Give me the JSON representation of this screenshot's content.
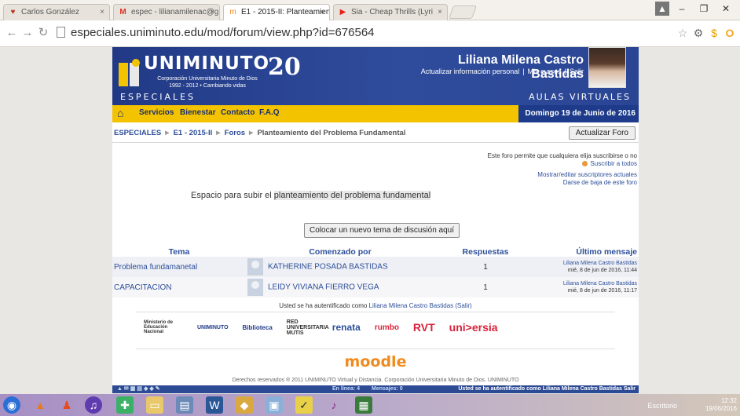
{
  "browser": {
    "tabs": [
      {
        "label": "Carlos González",
        "icon": "heart-icon"
      },
      {
        "label": "espec - lilianamilenac@g",
        "icon": "gmail-icon"
      },
      {
        "label": "E1 - 2015-II: Planteamien",
        "icon": "moodle-icon"
      },
      {
        "label": "Sia - Cheap Thrills (Lyri",
        "icon": "youtube-icon"
      }
    ],
    "url": "especiales.uniminuto.edu/mod/forum/view.php?id=676564"
  },
  "header": {
    "brand": "UNIMINUTO",
    "brand_sub": "Corporación Universitaria Minuto de Dios",
    "brand_years": "1992 - 2012  •  Cambiando vidas",
    "anniversary": "20",
    "user_name": "Liliana Milena Castro Bastidas",
    "links": [
      "Actualizar información personal",
      "Mis cursos",
      "Salir"
    ],
    "section_left": "ESPECIALES",
    "section_right": "AULAS VIRTUALES"
  },
  "nav": {
    "items": [
      "Servicios",
      "Bienestar",
      "Contacto",
      "F.A.Q"
    ],
    "date": "Domingo 19 de Junio de 2016"
  },
  "breadcrumb": {
    "items": [
      "ESPECIALES",
      "E1 - 2015-II",
      "Foros",
      "Planteamiento del Problema Fundamental"
    ],
    "update_button": "Actualizar Foro"
  },
  "subscription": {
    "note": "Este foro permite que cualquiera elija suscribirse o no",
    "subscribe_all": "Suscribir a todos",
    "show_edit": "Mostrar/editar suscriptores actuales",
    "unsubscribe": "Darse de baja de este foro"
  },
  "intro": {
    "prefix": "Espacio para subir el ",
    "highlight": "planteamiento del problema fundamental"
  },
  "new_topic_button": "Colocar un nuevo tema de discusión aquí",
  "table": {
    "headers": [
      "Tema",
      "Comenzado por",
      "Respuestas",
      "Último mensaje"
    ],
    "rows": [
      {
        "topic": "Problema fundamanetal",
        "author": "KATHERINE POSADA BASTIDAS",
        "replies": "1",
        "last_by": "Liliana Milena Castro Bastidas",
        "last_date": "mié, 8 de jun de 2016, 11:44"
      },
      {
        "topic": "CAPACITACION",
        "author": "LEIDY VIVIANA FIERRO VEGA",
        "replies": "1",
        "last_by": "Liliana Milena Castro Bastidas",
        "last_date": "mié, 8 de jun de 2016, 11:17"
      }
    ]
  },
  "auth": {
    "prefix": "Usted se ha autentificado como ",
    "user": "Liliana Milena Castro Bastidas",
    "logout": "(Salir)"
  },
  "partners": [
    "Ministerio de Educación Nacional",
    "UNIMINUTO",
    "Biblioteca",
    "RED UNIVERSITARIA MUTIS",
    "renata",
    "rumbo",
    "RVT",
    "uni>ersia"
  ],
  "footer": {
    "moodle": "moodle",
    "copyright": "Derechos reservados ® 2011 UNIMINUTO Virtual y Distancia. Corporación Universitaria Minuto de Dios. UNIMINUTO",
    "online": "En línea: 4",
    "messages": "Mensajes: 0",
    "auth_short": "Usted se ha autentificado como Liliana Milena Castro Bastidas  Salir"
  },
  "taskbar": {
    "desktop_label": "Escritorio",
    "time": "12:32",
    "date": "19/06/2016"
  }
}
